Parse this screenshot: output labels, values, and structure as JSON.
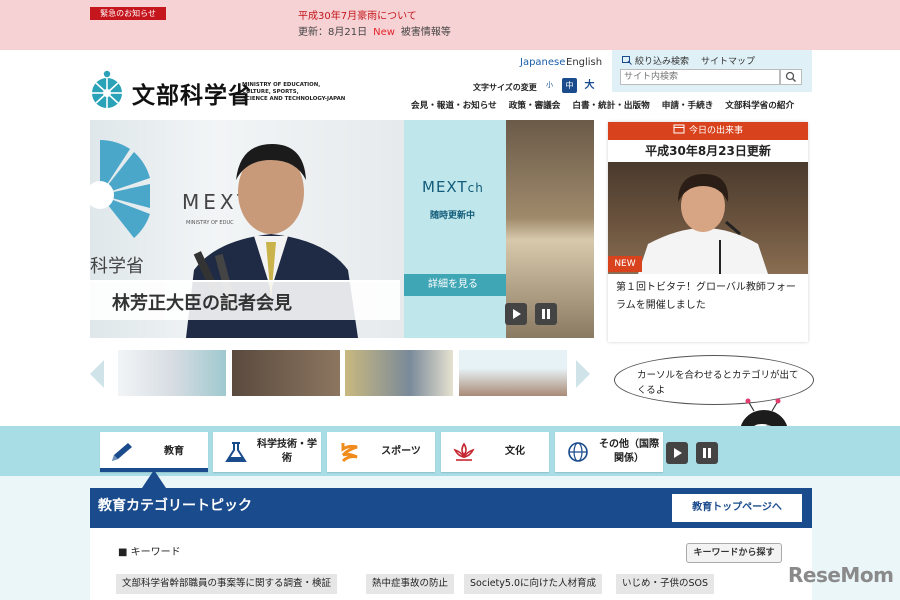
{
  "alert": {
    "badge": "緊急のお知らせ",
    "title": "平成30年7月豪雨について",
    "update_prefix": "更新：8月21日",
    "new": "New",
    "update_suffix": "被害情報等"
  },
  "header": {
    "logo_text": "文部科学省",
    "logo_en_1": "MINISTRY OF EDUCATION,",
    "logo_en_2": "CULTURE, SPORTS,",
    "logo_en_3": "SCIENCE AND TECHNOLOGY-JAPAN",
    "lang_japanese": "Japanese",
    "lang_english": "English",
    "fontsize_label": "文字サイズの変更",
    "fontsize_small": "小",
    "fontsize_medium": "中",
    "fontsize_large": "大",
    "narrow_search": "絞り込み検索",
    "sitemap": "サイトマップ",
    "search_placeholder": "サイト内検索"
  },
  "nav": [
    "会見・報道・お知らせ",
    "政策・審議会",
    "白書・統計・出版物",
    "申請・手続き",
    "文部科学省の紹介"
  ],
  "hero": {
    "caption": "林芳正大臣の記者会見",
    "mext_text": "MEXT",
    "ministry_text": "MINISTRY OF EDUC",
    "kanji_text": "科学省",
    "mextch_title": "MEXT",
    "mextch_ch": "ch",
    "mextch_sub": "随時更新中",
    "mextch_detail": "詳細を見る"
  },
  "today": {
    "header": "今日の出来事",
    "date": "平成30年8月23日更新",
    "badge": "NEW",
    "text": "第１回トビタテ！グローバル教師フォーラムを開催しました"
  },
  "bubble_text": "カーソルを合わせるとカテゴリが出てくるよ",
  "categories": [
    {
      "label": "教育"
    },
    {
      "label": "科学技術・学術"
    },
    {
      "label": "スポーツ"
    },
    {
      "label": "文化"
    },
    {
      "label": "その他（国際関係）"
    }
  ],
  "topic": {
    "title": "教育カテゴリートピック",
    "top_link": "教育トップページへ",
    "keyword_label": "■ キーワード",
    "keyword_search": "キーワードから探す",
    "tags": [
      "文部科学省幹部職員の事案等に関する調査・検証",
      "熱中症事故の防止",
      "Society5.0に向けた人材育成",
      "いじめ・子供のSOS"
    ]
  },
  "watermark": "ReseMom",
  "colors": {
    "alert_bg": "#f6d2d4",
    "alert_red": "#c4161c",
    "navy": "#1a4b8c",
    "category_bar": "#a9dde6",
    "today_accent": "#d8431e"
  }
}
